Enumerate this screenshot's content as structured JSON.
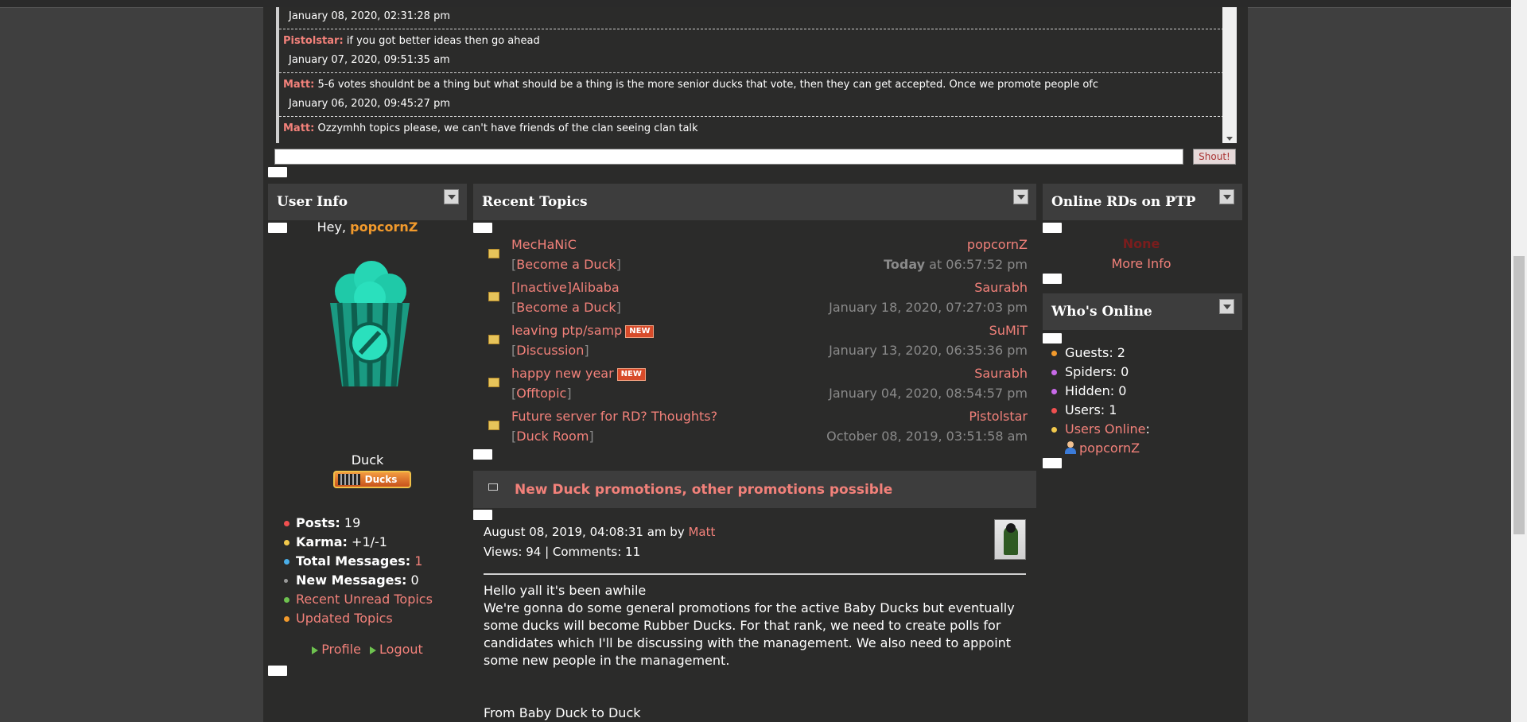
{
  "shoutbox": {
    "entries": [
      {
        "author": "",
        "message": "",
        "timestamp": "January 08, 2020, 02:31:28 pm"
      },
      {
        "author": "Pistolstar",
        "message": "if you got better ideas then go ahead",
        "timestamp": "January 07, 2020, 09:51:35 am"
      },
      {
        "author": "Matt",
        "message": "5-6 votes shouldnt be a thing but what should be a thing is the more senior ducks that vote, then they can get accepted. Once we promote people ofc",
        "timestamp": "January 06, 2020, 09:45:27 pm"
      },
      {
        "author": "Matt",
        "message": "Ozzymhh topics please, we can't have friends of the clan seeing clan talk"
      }
    ],
    "input_value": "",
    "shout_button": "Shout!"
  },
  "user_info": {
    "title": "User Info",
    "greeting": "Hey,",
    "username": "popcornZ",
    "rank": "Duck",
    "badge_label": "Ducks",
    "stats": [
      {
        "label": "Posts:",
        "value": "19",
        "dot": "#f05050"
      },
      {
        "label": "Karma:",
        "value": "+1/-1",
        "dot": "#f2c94c"
      },
      {
        "label": "Total Messages:",
        "value": "1",
        "dot": "#4aaee8"
      },
      {
        "label": "New Messages:",
        "value": "0",
        "dot": "#9a9a9a"
      }
    ],
    "links": [
      {
        "label": "Recent Unread Topics",
        "dot": "#6ec24f"
      },
      {
        "label": "Updated Topics",
        "dot": "#f29a2c"
      }
    ],
    "profile_label": "Profile",
    "logout_label": "Logout"
  },
  "recent_topics": {
    "title": "Recent Topics",
    "items": [
      {
        "title": "MecHaNiC",
        "board": "Become a Duck",
        "author": "popcornZ",
        "date_bold": "Today",
        "date": "at 06:57:52 pm",
        "is_new": false
      },
      {
        "title": "[Inactive]Alibaba",
        "board": "Become a Duck",
        "author": "Saurabh",
        "date_bold": "",
        "date": "January 18, 2020, 07:27:03 pm",
        "is_new": false
      },
      {
        "title": "leaving ptp/samp",
        "board": "Discussion",
        "author": "SuMiT",
        "date_bold": "",
        "date": "January 13, 2020, 06:35:36 pm",
        "is_new": true
      },
      {
        "title": "happy new year",
        "board": "Offtopic",
        "author": "Saurabh",
        "date_bold": "",
        "date": "January 04, 2020, 08:54:57 pm",
        "is_new": true
      },
      {
        "title": "Future server for RD? Thoughts?",
        "board": "Duck Room",
        "author": "Pistolstar",
        "date_bold": "",
        "date": "October 08, 2019, 03:51:58 am",
        "is_new": false
      }
    ],
    "new_label": "NEW"
  },
  "news": {
    "title": "New Duck promotions, other promotions possible",
    "posted": "August 08, 2019, 04:08:31 am by",
    "author": "Matt",
    "views_label": "Views: 94 | Comments: 11",
    "body_intro": "Hello yall it's been awhile",
    "body_main": "We're gonna do some general promotions for the active Baby Ducks but eventually some ducks will become Rubber Ducks. For that rank, we need to create polls for candidates which I'll be discussing with the management. We also need to appoint some new people in the management.",
    "body_footer": "From Baby Duck to Duck"
  },
  "online_rds": {
    "title": "Online RDs on PTP",
    "none_label": "None",
    "more_info": "More Info"
  },
  "whos_online": {
    "title": "Who's Online",
    "items": [
      {
        "label": "Guests: 2",
        "dot": "#f29a2c"
      },
      {
        "label": "Spiders: 0",
        "dot": "#c86ae8"
      },
      {
        "label": "Hidden: 0",
        "dot": "#c86ae8"
      },
      {
        "label": "Users: 1",
        "dot": "#f05050"
      }
    ],
    "users_online_label": "Users Online",
    "online_user": "popcornZ"
  }
}
